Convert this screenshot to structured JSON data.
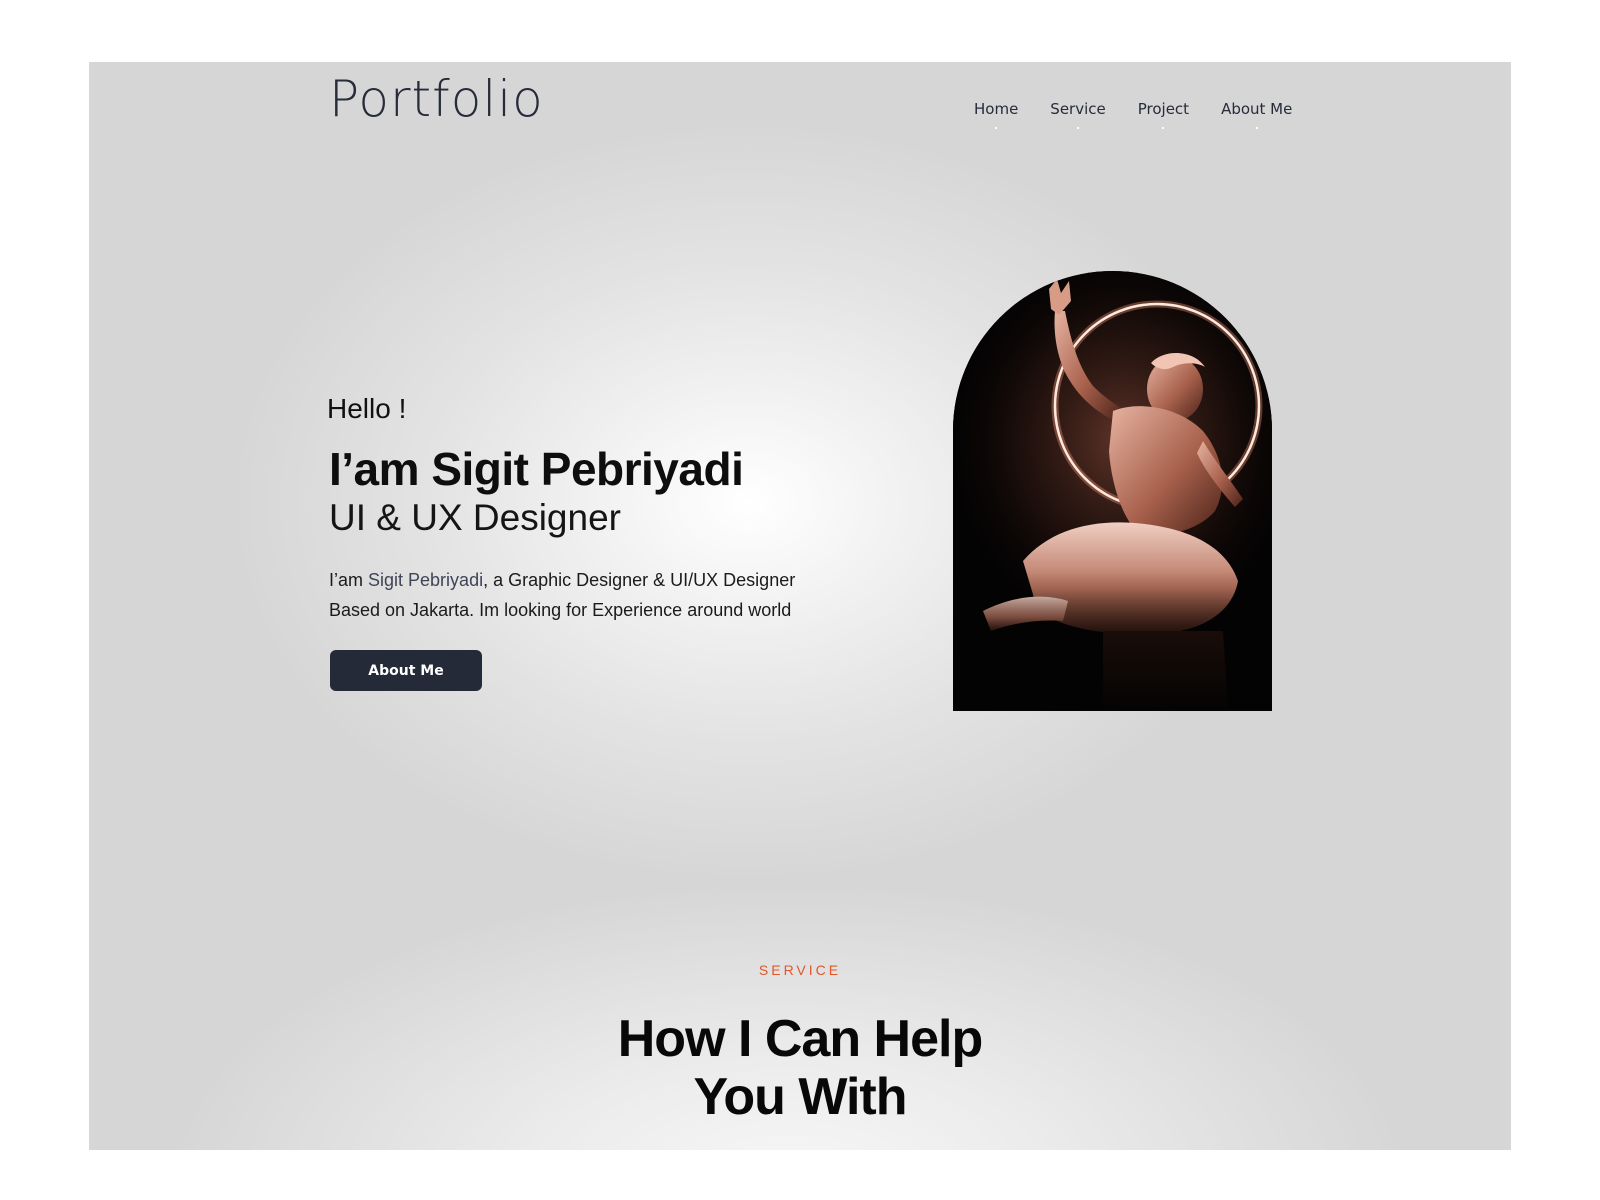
{
  "header": {
    "brand": "Portfolio",
    "nav": [
      {
        "label": "Home"
      },
      {
        "label": "Service"
      },
      {
        "label": "Project"
      },
      {
        "label": "About Me"
      }
    ]
  },
  "hero": {
    "greeting": "Hello !",
    "name": "I’am Sigit Pebriyadi",
    "role": "UI & UX Designer",
    "description": {
      "prefix": "I’am ",
      "highlight": "Sigit Pebriyadi",
      "suffix": ", a Graphic Designer & UI/UX Designer",
      "line2": "Based on Jakarta. Im looking for Experience around world"
    },
    "cta_label": "About Me",
    "image_icon": "statue-image"
  },
  "service": {
    "eyebrow": "SERVICE",
    "heading_line1": "How I Can Help",
    "heading_line2": "You With"
  },
  "colors": {
    "background": "#d6d6d6",
    "dark": "#252a38",
    "accent": "#e1572b",
    "highlight": "#3f4456"
  }
}
